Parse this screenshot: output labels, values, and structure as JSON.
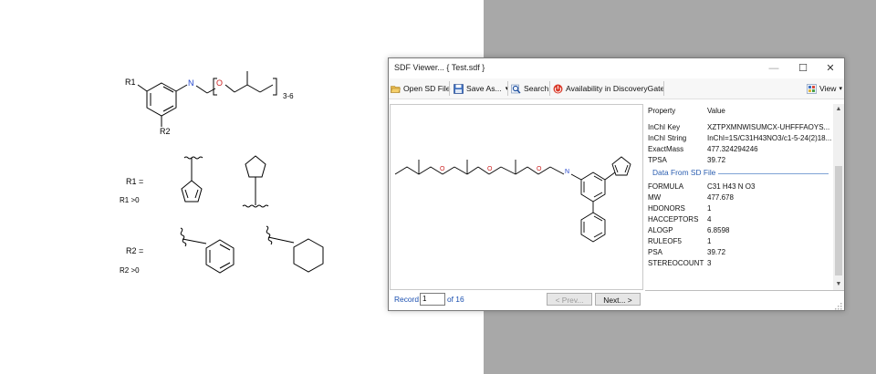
{
  "figure": {
    "r1_label": "R1",
    "r2_label": "R2",
    "repeat_label": "3-6",
    "n_atom": "N",
    "o_atom": "O",
    "r1_def_label": "R1 =",
    "r1_cond": "R1 >0",
    "r2_def_label": "R2 =",
    "r2_cond": "R2 >0"
  },
  "window": {
    "title": "SDF Viewer... { Test.sdf }",
    "min_glyph": "—",
    "max_glyph": "☐",
    "close_glyph": "✕"
  },
  "toolbar": {
    "open_label": "Open SD File",
    "save_label": "Save As...",
    "save_arrow": "▾",
    "search_label": "Search",
    "availability_label": "Availability in DiscoveryGate",
    "view_label": "View",
    "view_arrow": "▾"
  },
  "preview": {
    "n_atom": "N",
    "o_atom": "O"
  },
  "navigation": {
    "record_label": "Record",
    "record_value": "1",
    "of_label": "of 16",
    "prev_label": "< Prev...",
    "next_label": "Next... >"
  },
  "properties": {
    "header": {
      "property": "Property",
      "value": "Value"
    },
    "rows": [
      {
        "key": "InChI Key",
        "value": "XZTPXMNWISUMCX-UHFFFAOYS..."
      },
      {
        "key": "InChI String",
        "value": "InChI=1S/C31H43NO3/c1-5-24(2)18..."
      },
      {
        "key": "ExactMass",
        "value": "477.324294246"
      },
      {
        "key": "TPSA",
        "value": "39.72"
      }
    ],
    "section_label": "Data From SD File",
    "sd_rows": [
      {
        "key": "FORMULA",
        "value": "C31 H43 N O3"
      },
      {
        "key": "MW",
        "value": "477.678"
      },
      {
        "key": "HDONORS",
        "value": "1"
      },
      {
        "key": "HACCEPTORS",
        "value": "4"
      },
      {
        "key": "ALOGP",
        "value": "6.8598"
      },
      {
        "key": "RULEOF5",
        "value": "1"
      },
      {
        "key": "PSA",
        "value": "39.72"
      },
      {
        "key": "STEREOCOUNT",
        "value": "3"
      }
    ]
  },
  "scrollbar": {
    "up_glyph": "▲",
    "down_glyph": "▼"
  },
  "colors": {
    "link_blue": "#1a4fb0",
    "section_blue": "#2a5db0",
    "right_bg": "#a8a8a8",
    "atom_blue": "#2244cc",
    "atom_red": "#cc2222"
  }
}
